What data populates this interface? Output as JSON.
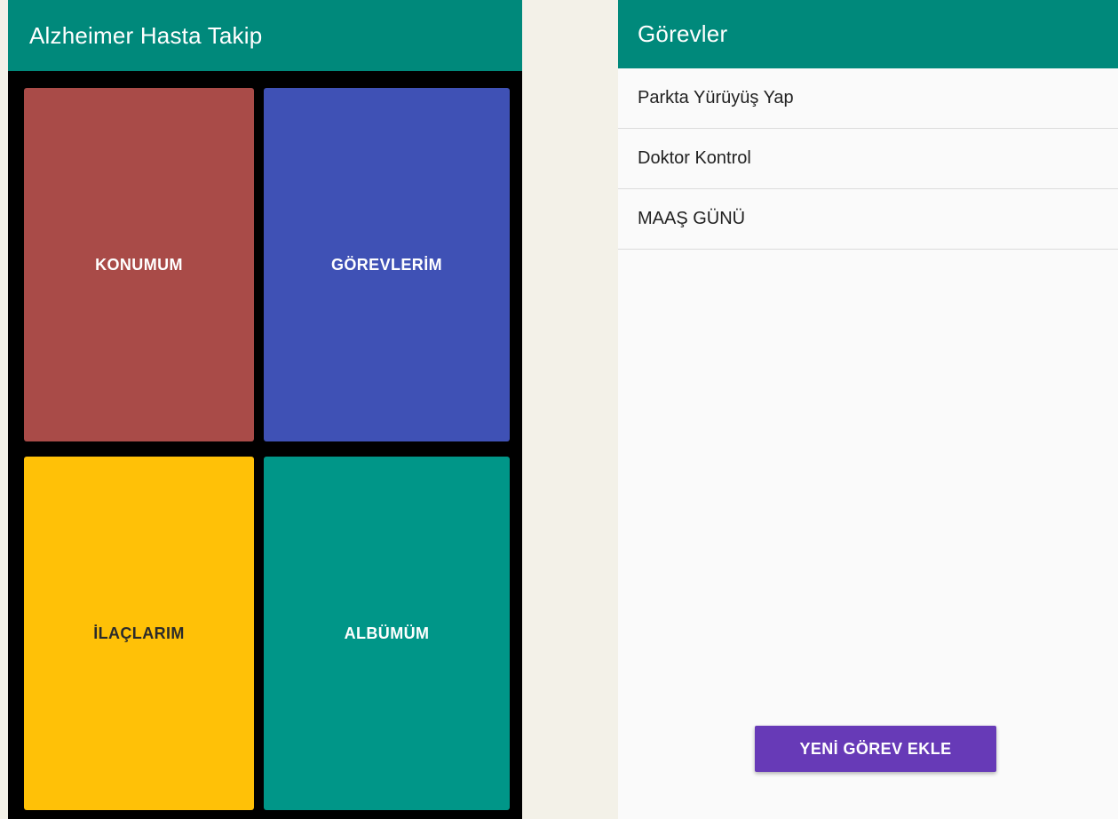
{
  "home_screen": {
    "title": "Alzheimer Hasta Takip",
    "tiles": [
      {
        "label": "KONUMUM",
        "color": "#a94b48"
      },
      {
        "label": "GÖREVLERİM",
        "color": "#3f51b5"
      },
      {
        "label": "İLAÇLARIM",
        "color": "#ffc107"
      },
      {
        "label": "ALBÜMÜM",
        "color": "#009688"
      }
    ]
  },
  "tasks_screen": {
    "title": "Görevler",
    "tasks": [
      {
        "label": "Parkta Yürüyüş Yap"
      },
      {
        "label": "Doktor Kontrol"
      },
      {
        "label": "MAAŞ GÜNÜ"
      }
    ],
    "add_button_label": "YENİ GÖREV EKLE"
  },
  "colors": {
    "app_bar": "#00897b",
    "button_primary": "#673ab7"
  }
}
